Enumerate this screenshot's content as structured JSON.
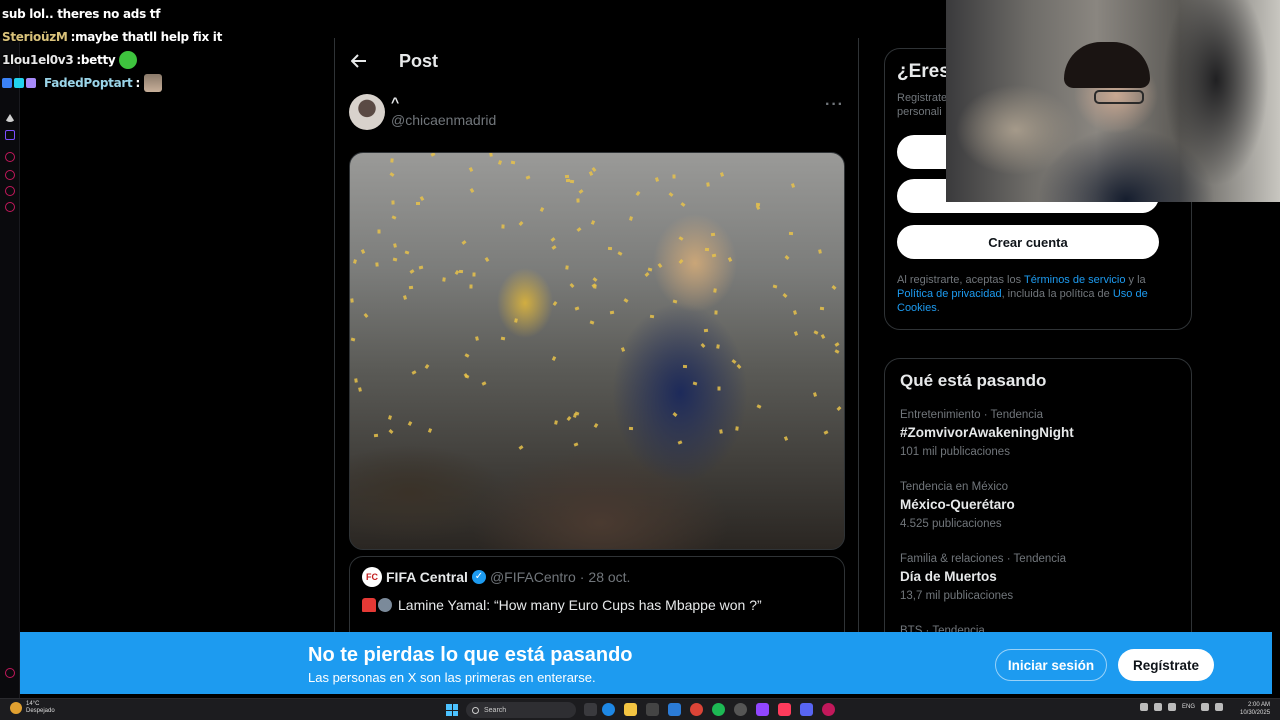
{
  "chat": {
    "lines": [
      {
        "user": "",
        "message": "sub lol.. theres no ads tf"
      },
      {
        "user": "SterioüzM",
        "separator": " : ",
        "message": "maybe thatll help fix it",
        "color": "#d9c27a"
      },
      {
        "user": "1lou1el0v3",
        "separator": " : ",
        "message": "betty",
        "color": "#e8e8e8"
      },
      {
        "user": "FadedPoptart",
        "separator": " : ",
        "message": "",
        "color": "#9ad4e8"
      }
    ]
  },
  "post": {
    "header_title": "Post",
    "author_name": "^",
    "author_handle": "@chicaenmadrid",
    "more": "···",
    "quote": {
      "logo_text": "FC",
      "name": "FIFA Central",
      "handle": "@FIFACentro",
      "dot": "·",
      "date": "28 oct.",
      "text": "Lamine Yamal: “How many Euro Cups has Mbappe won ?”"
    }
  },
  "signup": {
    "title": "¿Eres",
    "subtitle_line1": "Registrate",
    "subtitle_line2": "personali",
    "create_account": "Crear cuenta",
    "legal_1": "Al registrarte, aceptas los ",
    "terms_link": "Términos de servicio",
    "legal_2": " y la ",
    "privacy_link": "Política de privacidad",
    "legal_3": ", incluida la política de ",
    "cookies_link": "Uso de Cookies",
    "legal_4": "."
  },
  "trends": {
    "title": "Qué está pasando",
    "items": [
      {
        "meta": "Entretenimiento · Tendencia",
        "name": "#ZomvivorAwakeningNight",
        "count": "101 mil publicaciones"
      },
      {
        "meta": "Tendencia en México",
        "name": "México-Querétaro",
        "count": "4.525 publicaciones"
      },
      {
        "meta": "Familia & relaciones · Tendencia",
        "name": "Día de Muertos",
        "count": "13,7 mil publicaciones"
      },
      {
        "meta": "BTS · Tendencia",
        "name": "",
        "count": ""
      }
    ]
  },
  "banner": {
    "title": "No te pierdas lo que está pasando",
    "subtitle": "Las personas en X son las primeras en enterarse.",
    "login": "Iniciar sesión",
    "register": "Regístrate"
  },
  "taskbar": {
    "temperature": "14°C",
    "condition": "Despejado",
    "search_placeholder": "Search",
    "language": "ENG",
    "time": "2:00 AM",
    "date": "10/30/2025"
  },
  "colors": {
    "accent": "#1d9bf0",
    "background": "#000000",
    "border": "#2f3336",
    "muted_text": "#71767b"
  }
}
